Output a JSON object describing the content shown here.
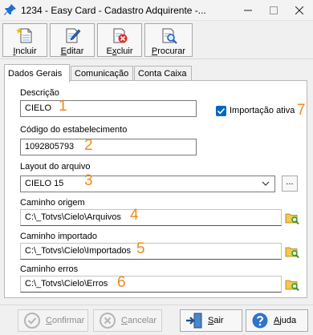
{
  "window": {
    "title": "1234 - Easy Card - Cadastro Adquirente -..."
  },
  "toolbar": {
    "items": [
      {
        "label_pre": "",
        "label_key": "I",
        "label_post": "ncluir"
      },
      {
        "label_pre": "",
        "label_key": "E",
        "label_post": "ditar"
      },
      {
        "label_pre": "E",
        "label_key": "x",
        "label_post": "cluir"
      },
      {
        "label_pre": "",
        "label_key": "P",
        "label_post": "rocurar"
      }
    ]
  },
  "tabs": [
    "Dados Gerais",
    "Comunicação",
    "Conta Caixa"
  ],
  "form": {
    "descricao_label": "Descrição",
    "descricao_value": "CIELO",
    "importacao_label": "Importação ativa",
    "codigo_label": "Código do estabelecimento",
    "codigo_value": "1092805793",
    "layout_label": "Layout do arquivo",
    "layout_value": "CIELO 15",
    "layout_more": "...",
    "origem_label": "Caminho origem",
    "origem_value": "C:\\_Totvs\\Cielo\\Arquivos",
    "importado_label": "Caminho importado",
    "importado_value": "C:\\_Totvs\\Cielo\\Importados",
    "erros_label": "Caminho erros",
    "erros_value": "C:\\_Totvs\\Cielo\\Erros"
  },
  "markers": [
    "1",
    "2",
    "3",
    "4",
    "5",
    "6",
    "7"
  ],
  "buttons": {
    "confirmar_key": "C",
    "confirmar_rest": "onfirmar",
    "cancelar_key": "C",
    "cancelar_rest": "ancelar",
    "sair_key": "S",
    "sair_rest": "air",
    "ajuda_key": "A",
    "ajuda_rest": "juda"
  },
  "colors": {
    "marker": "#f08a1c",
    "accent": "#0067c0"
  }
}
